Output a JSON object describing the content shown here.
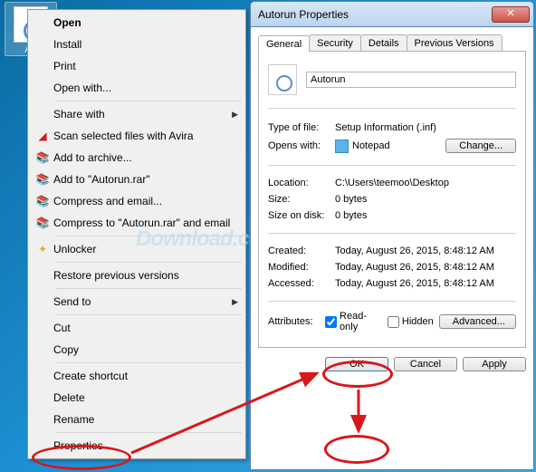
{
  "desktop": {
    "icon_label": "Au"
  },
  "context_menu": {
    "open": "Open",
    "install": "Install",
    "print": "Print",
    "open_with": "Open with...",
    "share_with": "Share with",
    "scan_avira": "Scan selected files with Avira",
    "add_archive": "Add to archive...",
    "add_autorun_rar": "Add to \"Autorun.rar\"",
    "compress_email": "Compress and email...",
    "compress_autorun_email": "Compress to \"Autorun.rar\" and email",
    "unlocker": "Unlocker",
    "restore_versions": "Restore previous versions",
    "send_to": "Send to",
    "cut": "Cut",
    "copy": "Copy",
    "create_shortcut": "Create shortcut",
    "delete": "Delete",
    "rename": "Rename",
    "properties": "Properties"
  },
  "dialog": {
    "title": "Autorun Properties",
    "tabs": {
      "general": "General",
      "security": "Security",
      "details": "Details",
      "previous": "Previous Versions"
    },
    "filename": "Autorun",
    "labels": {
      "type_of_file": "Type of file:",
      "opens_with": "Opens with:",
      "location": "Location:",
      "size": "Size:",
      "size_on_disk": "Size on disk:",
      "created": "Created:",
      "modified": "Modified:",
      "accessed": "Accessed:",
      "attributes": "Attributes:",
      "read_only": "Read-only",
      "hidden": "Hidden"
    },
    "values": {
      "type_of_file": "Setup Information (.inf)",
      "opens_with": "Notepad",
      "location": "C:\\Users\\teemoo\\Desktop",
      "size": "0 bytes",
      "size_on_disk": "0 bytes",
      "created": "Today, August 26, 2015, 8:48:12 AM",
      "modified": "Today, August 26, 2015, 8:48:12 AM",
      "accessed": "Today, August 26, 2015, 8:48:12 AM"
    },
    "buttons": {
      "change": "Change...",
      "advanced": "Advanced...",
      "ok": "OK",
      "cancel": "Cancel",
      "apply": "Apply"
    }
  },
  "watermark": "Download.com.vn"
}
